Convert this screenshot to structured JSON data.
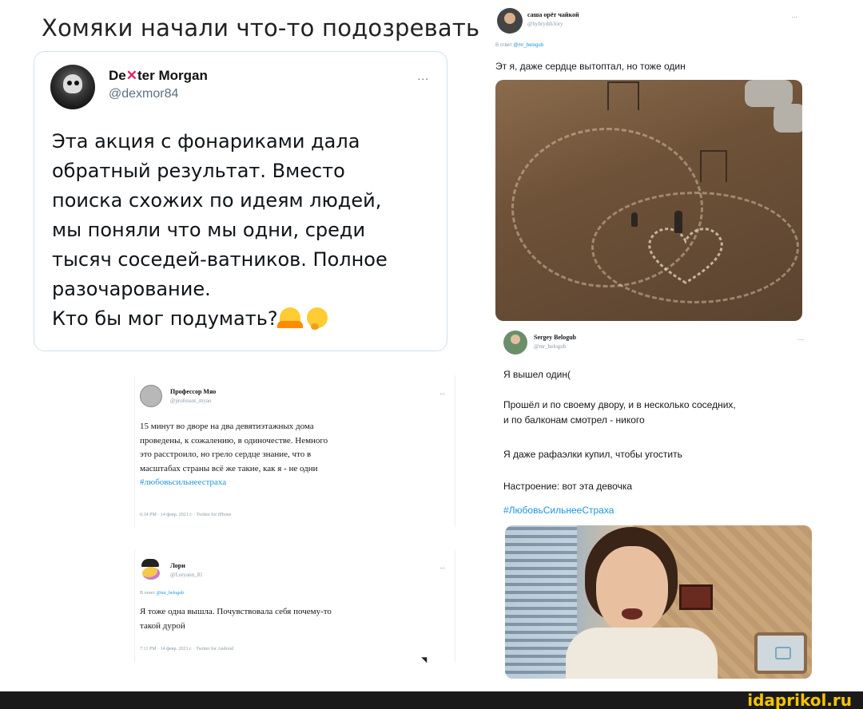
{
  "page_title": "Хомяки начали что-то подозревать",
  "big_tweet": {
    "name_prefix": "De",
    "name_x": "✕",
    "name_suffix": "ter Morgan",
    "handle": "@dexmor84",
    "more": "...",
    "text_lines": [
      "Эта акция с фонариками дала",
      "обратный результат. Вместо",
      "поиска схожих по идеям людей,",
      "мы поняли что мы одни, среди",
      "тысяч соседей-ватников. Полное",
      "разочарование.",
      "Кто бы мог подумать?"
    ],
    "emoji_icons": [
      "person-shrugging-emoji-icon",
      "thinking-face-emoji-icon"
    ]
  },
  "tweet_professor": {
    "name": "Профессор Мяо",
    "handle": "@professor_myao",
    "more": "...",
    "lines": [
      "15 минут во дворе на два девятиэтажных дома",
      "проведены, к сожалению, в одиночестве. Немного",
      "это расстроило, но грело сердце знание, что в",
      "масштабах страны всё же такие, как я - не одни"
    ],
    "hashtag": "#любовьсильнеестраха",
    "meta": "6:14 PM · 14 февр. 2021 г. · Twitter for iPhone"
  },
  "tweet_lori": {
    "name": "Лори",
    "handle": "@Loryann_81",
    "more": "...",
    "reply_prefix": "В ответ",
    "reply_to": "@mr_belogub",
    "lines": [
      "Я тоже одна вышла. Почувствовала себя почему-то",
      "такой дурой"
    ],
    "meta": "7:11 PM · 14 февр. 2021 г. · Twitter for Android"
  },
  "tweet_sasha": {
    "name": "саша орёт чайкой",
    "handle": "@hybrydth3ory",
    "more": "...",
    "reply_prefix": "В ответ",
    "reply_to": "@mr_belogub",
    "text": "Эт я, даже сердце вытоптал, но тоже один"
  },
  "tweet_sergey": {
    "name": "Sergey Belogub",
    "handle": "@mr_belogub",
    "more": "...",
    "line1": "Я вышел один(",
    "line2a": "Прошёл и по своему двору, и в несколько соседних,",
    "line2b": "и по балконам смотрел - никого",
    "line3": "Я даже рафаэлки купил, чтобы угостить",
    "line4": "Настроение: вот эта девочка",
    "hashtag": "#ЛюбовьСильнееСтраха"
  },
  "watermark": "idaprikol.ru",
  "colors": {
    "link": "#1b95e0",
    "watermark": "#f5c400",
    "footer_bg": "#1a1a1a"
  }
}
